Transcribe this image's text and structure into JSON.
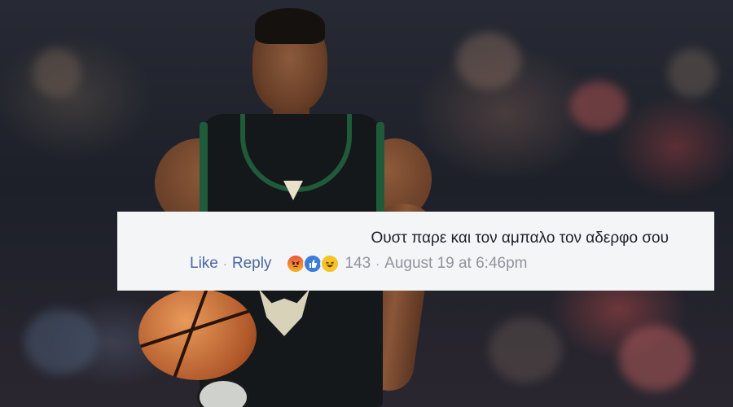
{
  "comment": {
    "text": "Ουστ παρε και τον αμπαλο τον αδερφο σου",
    "like_label": "Like",
    "reply_label": "Reply",
    "separator": "·",
    "reaction_icons": [
      "angry-reaction-icon",
      "like-reaction-icon",
      "haha-reaction-icon"
    ],
    "reaction_count": "143",
    "timestamp": "August 19 at 6:46pm"
  },
  "colors": {
    "link": "#4b67a1",
    "meta_gray": "#90949c",
    "comment_bg": "#f4f5f7",
    "jersey_green": "#1f5a3a"
  }
}
